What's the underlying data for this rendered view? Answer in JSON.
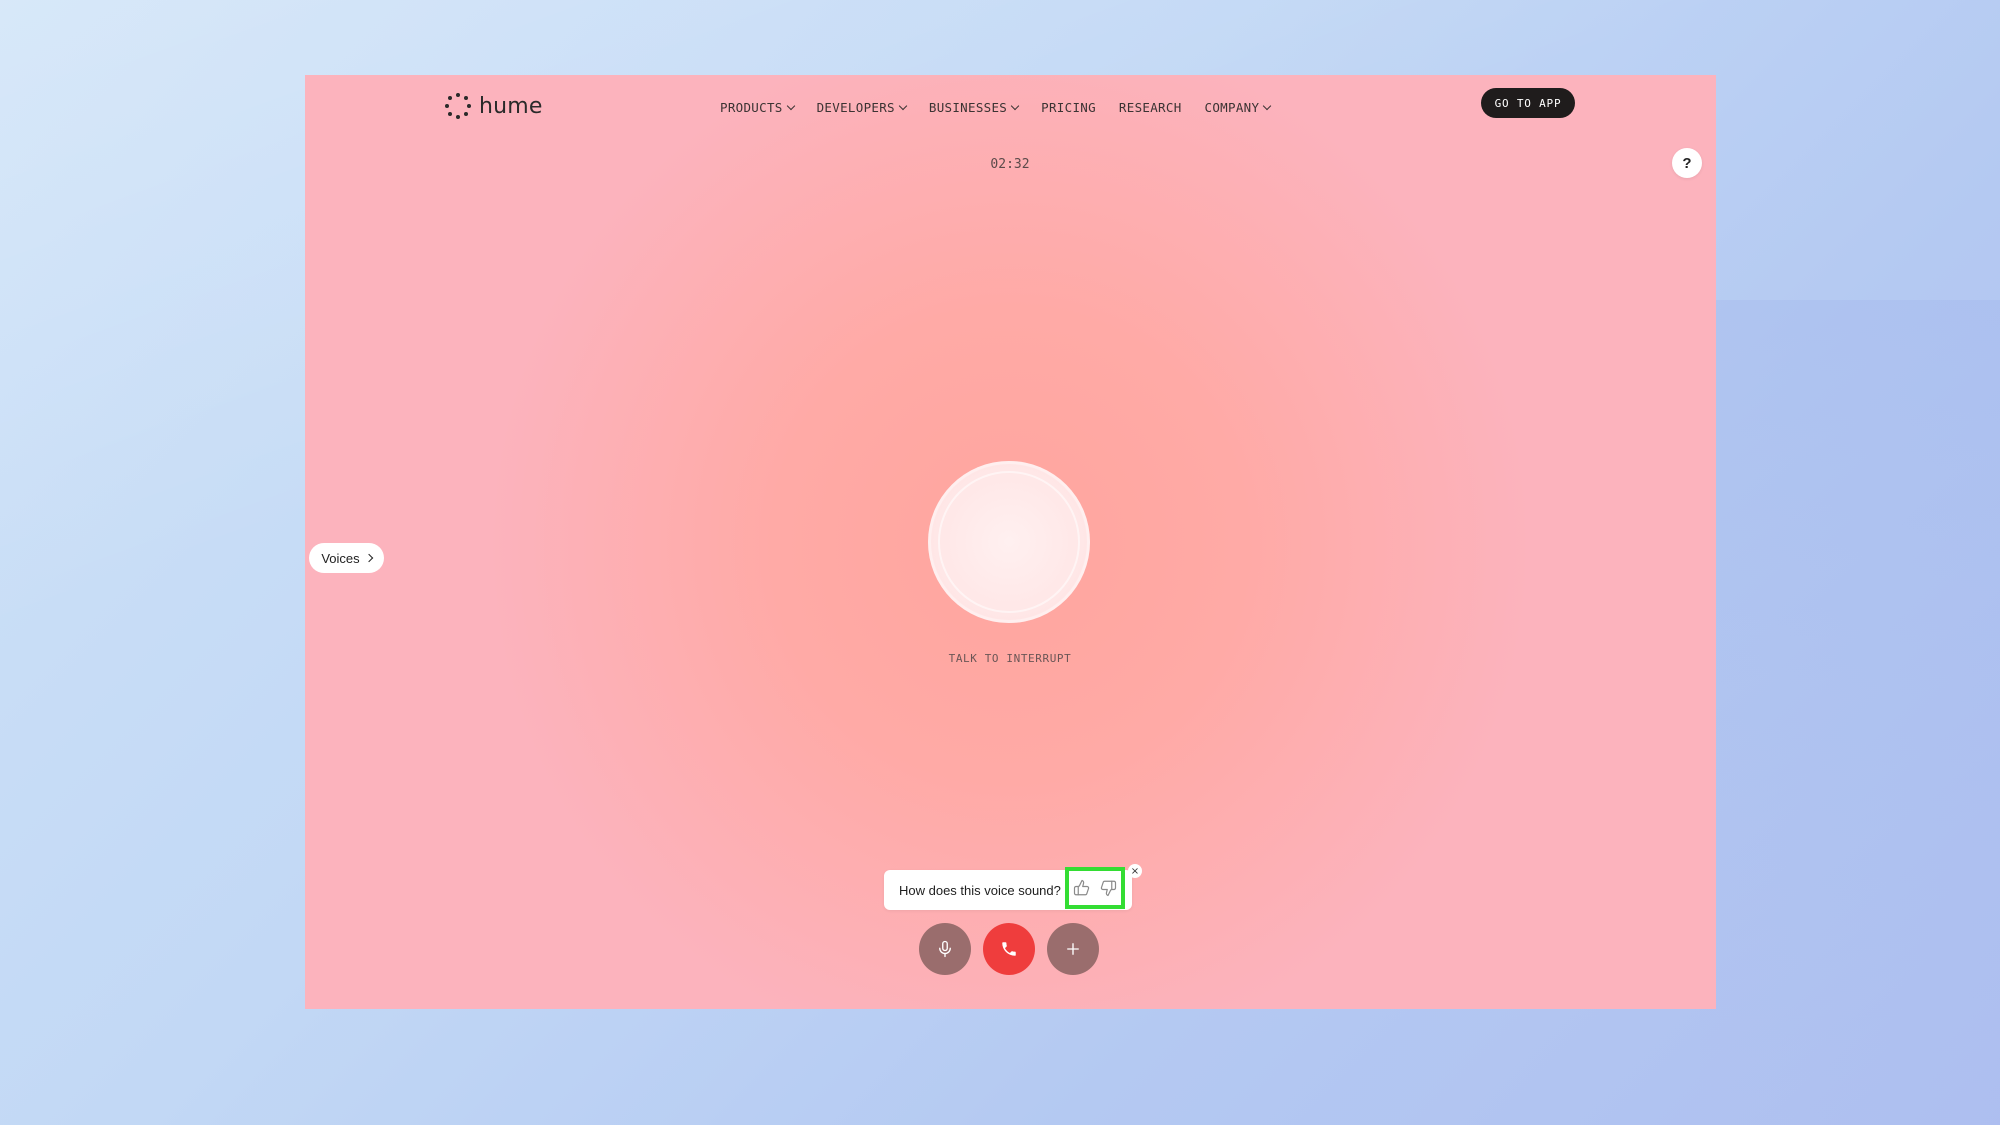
{
  "brand": {
    "name": "hume"
  },
  "nav": {
    "items": [
      {
        "label": "PRODUCTS",
        "dropdown": true
      },
      {
        "label": "DEVELOPERS",
        "dropdown": true
      },
      {
        "label": "BUSINESSES",
        "dropdown": true
      },
      {
        "label": "PRICING",
        "dropdown": false
      },
      {
        "label": "RESEARCH",
        "dropdown": false
      },
      {
        "label": "COMPANY",
        "dropdown": true
      }
    ],
    "cta_label": "GO TO APP"
  },
  "help": {
    "label": "?"
  },
  "call": {
    "timer": "02:32",
    "status": "TALK TO INTERRUPT"
  },
  "voices": {
    "label": "Voices"
  },
  "feedback": {
    "question": "How does this voice sound?",
    "close": "×"
  },
  "colors": {
    "end_call": "#ef3d3d",
    "control_muted": "#9a6d6d",
    "highlight": "#33dd33",
    "cta": "#1f1c1c"
  },
  "icons": {
    "mic": "microphone-icon",
    "end": "phone-icon",
    "add": "plus-icon",
    "like": "thumbs-up-icon",
    "dislike": "thumbs-down-icon"
  }
}
